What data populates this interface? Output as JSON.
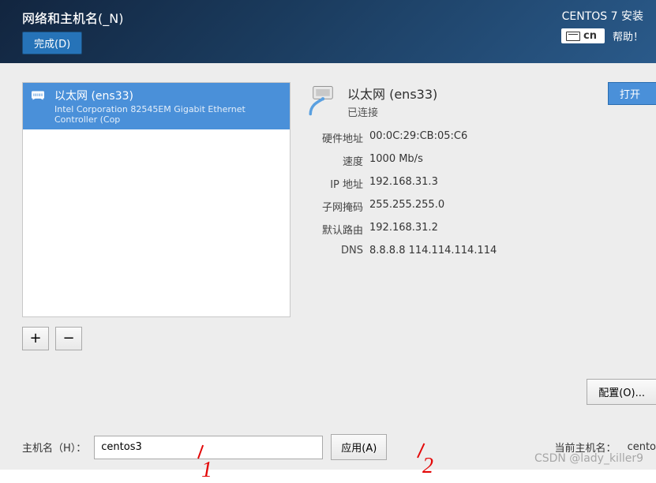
{
  "header": {
    "title": "网络和主机名(_N)",
    "done_label": "完成(D)",
    "brand": "CENTOS 7 安装",
    "lang": "cn",
    "help_label": "帮助！"
  },
  "nic_list": {
    "items": [
      {
        "name": "以太网 (ens33)",
        "sub": "Intel Corporation 82545EM Gigabit Ethernet Controller (Cop",
        "selected": true
      }
    ],
    "add_label": "+",
    "remove_label": "−"
  },
  "details": {
    "name": "以太网 (ens33)",
    "status": "已连接",
    "open_label": "打开",
    "rows": [
      {
        "label": "硬件地址",
        "value": "00:0C:29:CB:05:C6"
      },
      {
        "label": "速度",
        "value": "1000 Mb/s"
      },
      {
        "label": "IP 地址",
        "value": "192.168.31.3"
      },
      {
        "label": "子网掩码",
        "value": "255.255.255.0"
      },
      {
        "label": "默认路由",
        "value": "192.168.31.2"
      },
      {
        "label": "DNS",
        "value": "8.8.8.8 114.114.114.114"
      }
    ],
    "config_label": "配置(O)..."
  },
  "hostname": {
    "label": "主机名（H）：",
    "value": "centos3",
    "apply_label": "应用(A)",
    "current_label": "当前主机名：",
    "current_value": "cento"
  },
  "annotations": {
    "one": "1",
    "two": "2"
  },
  "watermark": "CSDN @lady_killer9"
}
